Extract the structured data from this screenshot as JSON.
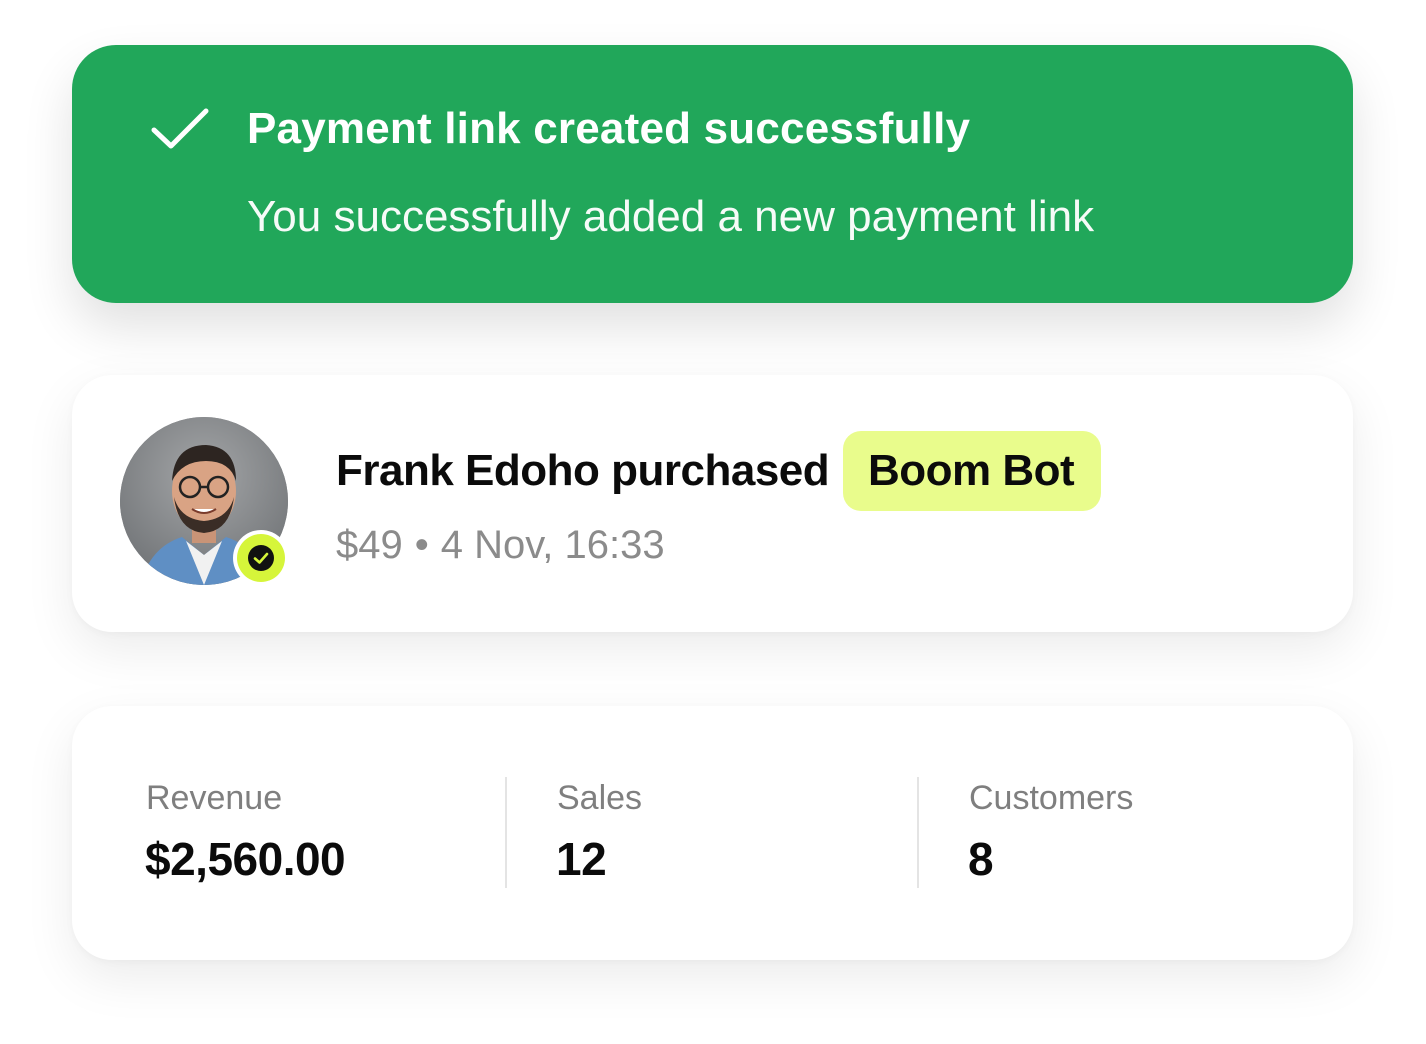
{
  "toast": {
    "title": "Payment link created successfully",
    "subtitle": "You successfully added a new payment link",
    "icon": "check-icon",
    "color": "#21a75a"
  },
  "purchase": {
    "avatar_icon": "user-avatar",
    "verified_icon": "verified-check-icon",
    "line": "Frank Edoho purchased",
    "product": "Boom Bot",
    "price": "$49",
    "separator": "•",
    "datetime": "4 Nov, 16:33",
    "chip_color": "#e9fc8c",
    "badge_color": "#d6f53a"
  },
  "stats": [
    {
      "label": "Revenue",
      "value": "$2,560.00"
    },
    {
      "label": "Sales",
      "value": "12"
    },
    {
      "label": "Customers",
      "value": "8"
    }
  ]
}
